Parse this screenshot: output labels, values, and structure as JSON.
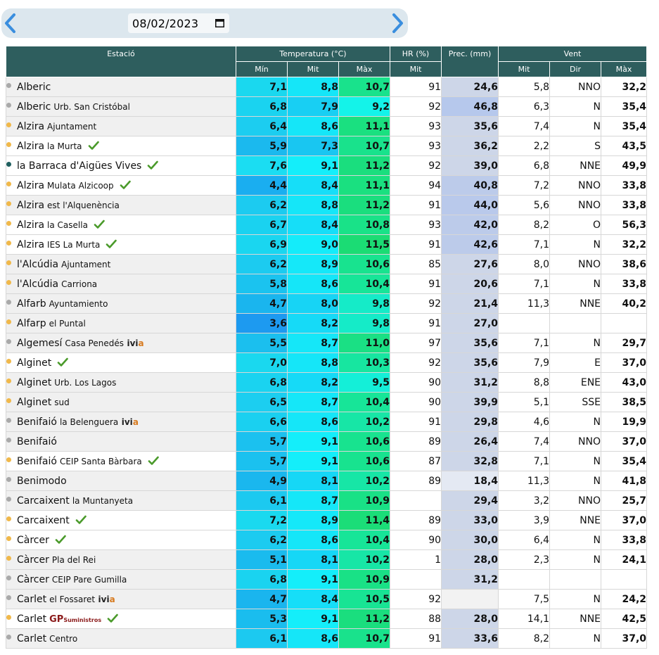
{
  "nav": {
    "date": "08/02/2023",
    "prev_icon": "chevron-left-icon",
    "next_icon": "chevron-right-icon",
    "calendar_icon": "calendar-icon"
  },
  "header": {
    "station": "Estació",
    "temperature": "Temperatura (°C)",
    "hr": "HR (%)",
    "prec": "Prec. (mm)",
    "wind": "Vent",
    "t_min": "Mín",
    "t_mit": "Mit",
    "t_max": "Màx",
    "hr_mit": "Mit",
    "w_mit": "Mit",
    "w_dir": "Dir",
    "w_max": "Màx"
  },
  "colors": {
    "header_bg": "#2e5e5e",
    "dot_gray": "#a9a9a9",
    "dot_orange": "#f0b84a",
    "dot_teal": "#1f5f5f",
    "check_green": "#4a9a2a"
  },
  "rows": [
    {
      "name": "Alberic",
      "sub": "",
      "dot": "gray",
      "check": false,
      "ivia": false,
      "gp": false,
      "min": "7,1",
      "mit": "8,8",
      "max": "10,7",
      "hr": "91",
      "prec": "24,6",
      "wmit": "5,8",
      "wdir": "NNO",
      "wmax": "32,2",
      "shade": "gray",
      "minc": "#1ad8ef",
      "mitc": "#15e6f8",
      "maxc": "#19e28c",
      "precc": "#cdd6e8"
    },
    {
      "name": "Alberic",
      "sub": "Urb. San Cristóbal",
      "dot": "gray",
      "check": false,
      "ivia": false,
      "gp": false,
      "min": "6,8",
      "mit": "7,9",
      "max": "9,2",
      "hr": "92",
      "prec": "46,8",
      "wmit": "6,3",
      "wdir": "N",
      "wmax": "35,4",
      "shade": "gray",
      "minc": "#1ad3f0",
      "mitc": "#18cff3",
      "maxc": "#14f3e9",
      "precc": "#b6c8ec"
    },
    {
      "name": "Alzira",
      "sub": "Ajuntament",
      "dot": "orange",
      "check": false,
      "ivia": false,
      "gp": false,
      "min": "6,4",
      "mit": "8,6",
      "max": "11,1",
      "hr": "93",
      "prec": "35,6",
      "wmit": "7,4",
      "wdir": "N",
      "wmax": "35,4",
      "shade": "gray",
      "minc": "#1ccdf0",
      "mitc": "#15e6f8",
      "maxc": "#1ae080",
      "precc": "#cdd6e8"
    },
    {
      "name": "Alzira",
      "sub": "la Murta",
      "dot": "orange",
      "check": true,
      "ivia": false,
      "gp": false,
      "min": "5,9",
      "mit": "7,3",
      "max": "10,7",
      "hr": "93",
      "prec": "36,2",
      "wmit": "2,2",
      "wdir": "S",
      "wmax": "43,5",
      "shade": "white",
      "minc": "#1bb9ee",
      "mitc": "#19c6f1",
      "maxc": "#19e28c",
      "precc": "#cdd6e8"
    },
    {
      "name": "la Barraca d'Aigües Vives",
      "sub": "",
      "dot": "teal",
      "check": true,
      "ivia": false,
      "gp": false,
      "min": "7,6",
      "mit": "9,1",
      "max": "11,2",
      "hr": "92",
      "prec": "39,0",
      "wmit": "6,8",
      "wdir": "NNE",
      "wmax": "49,9",
      "shade": "white",
      "minc": "#1bddf2",
      "mitc": "#14eefa",
      "maxc": "#1ade7e",
      "precc": "#cdd6e8"
    },
    {
      "name": "Alzira",
      "sub": "Mulata Alzicoop",
      "dot": "orange",
      "check": true,
      "ivia": false,
      "gp": false,
      "min": "4,4",
      "mit": "8,4",
      "max": "11,1",
      "hr": "94",
      "prec": "40,8",
      "wmit": "7,2",
      "wdir": "NNO",
      "wmax": "33,8",
      "shade": "white",
      "minc": "#1aaef0",
      "mitc": "#16def8",
      "maxc": "#1ae080",
      "precc": "#bccbea"
    },
    {
      "name": "Alzira",
      "sub": "est l'Alquenència",
      "dot": "orange",
      "check": false,
      "ivia": false,
      "gp": false,
      "min": "6,2",
      "mit": "8,8",
      "max": "11,2",
      "hr": "91",
      "prec": "44,0",
      "wmit": "5,6",
      "wdir": "NNO",
      "wmax": "33,8",
      "shade": "gray",
      "minc": "#1ccbf0",
      "mitc": "#15e6f8",
      "maxc": "#1ade7e",
      "precc": "#b9c9eb"
    },
    {
      "name": "Alzira",
      "sub": "la Casella",
      "dot": "orange",
      "check": true,
      "ivia": false,
      "gp": false,
      "min": "6,7",
      "mit": "8,4",
      "max": "10,8",
      "hr": "93",
      "prec": "42,0",
      "wmit": "8,2",
      "wdir": "O",
      "wmax": "56,3",
      "shade": "white",
      "minc": "#1ad2f0",
      "mitc": "#16def8",
      "maxc": "#19e288",
      "precc": "#bccbea"
    },
    {
      "name": "Alzira",
      "sub": "IES La Murta",
      "dot": "orange",
      "check": true,
      "ivia": false,
      "gp": false,
      "min": "6,9",
      "mit": "9,0",
      "max": "11,5",
      "hr": "91",
      "prec": "42,6",
      "wmit": "7,1",
      "wdir": "N",
      "wmax": "32,2",
      "shade": "white",
      "minc": "#1ad6f0",
      "mitc": "#14ecfa",
      "maxc": "#1bdc74",
      "precc": "#bccbea"
    },
    {
      "name": "l'Alcúdia",
      "sub": "Ajuntament",
      "dot": "orange",
      "check": false,
      "ivia": false,
      "gp": false,
      "min": "6,2",
      "mit": "8,9",
      "max": "10,6",
      "hr": "85",
      "prec": "27,6",
      "wmit": "8,0",
      "wdir": "NNO",
      "wmax": "38,6",
      "shade": "gray",
      "minc": "#1ccbf0",
      "mitc": "#15e8f9",
      "maxc": "#18e38f",
      "precc": "#cdd6e8"
    },
    {
      "name": "l'Alcúdia",
      "sub": "Carriona",
      "dot": "orange",
      "check": false,
      "ivia": false,
      "gp": false,
      "min": "5,8",
      "mit": "8,6",
      "max": "10,4",
      "hr": "91",
      "prec": "20,6",
      "wmit": "7,1",
      "wdir": "N",
      "wmax": "33,8",
      "shade": "gray",
      "minc": "#1bc3ef",
      "mitc": "#15e6f8",
      "maxc": "#17e598",
      "precc": "#cdd6e8"
    },
    {
      "name": "Alfarb",
      "sub": "Ayuntamiento",
      "dot": "gray",
      "check": false,
      "ivia": false,
      "gp": false,
      "min": "4,7",
      "mit": "8,0",
      "max": "9,8",
      "hr": "92",
      "prec": "21,4",
      "wmit": "11,3",
      "wdir": "NNE",
      "wmax": "40,2",
      "shade": "gray",
      "minc": "#1ab5ee",
      "mitc": "#17d4f5",
      "maxc": "#15ebc8",
      "precc": "#cdd6e8"
    },
    {
      "name": "Alfarp",
      "sub": "el Puntal",
      "dot": "orange",
      "check": false,
      "ivia": false,
      "gp": false,
      "min": "3,6",
      "mit": "8,2",
      "max": "9,8",
      "hr": "91",
      "prec": "27,0",
      "wmit": "",
      "wdir": "",
      "wmax": "",
      "shade": "gray",
      "minc": "#1d9af0",
      "mitc": "#16daf7",
      "maxc": "#15ebc8",
      "precc": "#cdd6e8"
    },
    {
      "name": "Algemesí",
      "sub": "Casa Penedés",
      "dot": "gray",
      "check": false,
      "ivia": true,
      "gp": false,
      "min": "5,5",
      "mit": "8,7",
      "max": "11,0",
      "hr": "97",
      "prec": "35,6",
      "wmit": "7,1",
      "wdir": "N",
      "wmax": "29,7",
      "shade": "gray",
      "minc": "#1bbfee",
      "mitc": "#15e7f8",
      "maxc": "#1ae084",
      "precc": "#cdd6e8"
    },
    {
      "name": "Alginet",
      "sub": "",
      "dot": "orange",
      "check": true,
      "ivia": false,
      "gp": false,
      "min": "7,0",
      "mit": "8,8",
      "max": "10,3",
      "hr": "92",
      "prec": "35,6",
      "wmit": "7,9",
      "wdir": "E",
      "wmax": "37,0",
      "shade": "white",
      "minc": "#1ad8ef",
      "mitc": "#15e6f8",
      "maxc": "#17e6a0",
      "precc": "#cdd6e8"
    },
    {
      "name": "Alginet",
      "sub": "Urb. Los Lagos",
      "dot": "orange",
      "check": false,
      "ivia": false,
      "gp": false,
      "min": "6,8",
      "mit": "8,2",
      "max": "9,5",
      "hr": "90",
      "prec": "31,2",
      "wmit": "8,8",
      "wdir": "ENE",
      "wmax": "43,0",
      "shade": "gray",
      "minc": "#1ad3f0",
      "mitc": "#16daf7",
      "maxc": "#14efd8",
      "precc": "#cdd6e8"
    },
    {
      "name": "Alginet",
      "sub": "sud",
      "dot": "orange",
      "check": false,
      "ivia": false,
      "gp": false,
      "min": "6,5",
      "mit": "8,7",
      "max": "10,4",
      "hr": "90",
      "prec": "39,9",
      "wmit": "5,1",
      "wdir": "SSE",
      "wmax": "38,5",
      "shade": "gray",
      "minc": "#1ccef0",
      "mitc": "#15e7f8",
      "maxc": "#17e598",
      "precc": "#cdd6e8"
    },
    {
      "name": "Benifaió",
      "sub": "la Belenguera",
      "dot": "gray",
      "check": false,
      "ivia": true,
      "gp": false,
      "min": "6,6",
      "mit": "8,6",
      "max": "10,2",
      "hr": "91",
      "prec": "29,8",
      "wmit": "4,6",
      "wdir": "N",
      "wmax": "19,9",
      "shade": "gray",
      "minc": "#1ad0f0",
      "mitc": "#15e6f8",
      "maxc": "#17e6a6",
      "precc": "#cdd6e8"
    },
    {
      "name": "Benifaió",
      "sub": "",
      "dot": "gray",
      "check": false,
      "ivia": false,
      "gp": false,
      "min": "5,7",
      "mit": "9,1",
      "max": "10,6",
      "hr": "89",
      "prec": "26,4",
      "wmit": "7,4",
      "wdir": "NNO",
      "wmax": "37,0",
      "shade": "gray",
      "minc": "#1bc1ef",
      "mitc": "#14eefa",
      "maxc": "#18e38f",
      "precc": "#cdd6e8"
    },
    {
      "name": "Benifaió",
      "sub": "CEIP Santa Bàrbara",
      "dot": "orange",
      "check": true,
      "ivia": false,
      "gp": false,
      "min": "5,7",
      "mit": "9,1",
      "max": "10,6",
      "hr": "87",
      "prec": "32,8",
      "wmit": "7,1",
      "wdir": "N",
      "wmax": "35,4",
      "shade": "white",
      "minc": "#1bc1ef",
      "mitc": "#14eefa",
      "maxc": "#18e38f",
      "precc": "#cdd6e8"
    },
    {
      "name": "Benimodo",
      "sub": "",
      "dot": "gray",
      "check": false,
      "ivia": false,
      "gp": false,
      "min": "4,9",
      "mit": "8,1",
      "max": "10,2",
      "hr": "89",
      "prec": "18,4",
      "wmit": "11,3",
      "wdir": "N",
      "wmax": "41,8",
      "shade": "gray",
      "minc": "#1ab7ee",
      "mitc": "#16d7f6",
      "maxc": "#17e6a6",
      "precc": "#e4e9f3"
    },
    {
      "name": "Carcaixent",
      "sub": "la Muntanyeta",
      "dot": "gray",
      "check": false,
      "ivia": false,
      "gp": false,
      "min": "6,1",
      "mit": "8,7",
      "max": "10,9",
      "hr": "",
      "prec": "29,4",
      "wmit": "3,2",
      "wdir": "NNO",
      "wmax": "25,7",
      "shade": "gray",
      "minc": "#1cc9f0",
      "mitc": "#15e7f8",
      "maxc": "#19e186",
      "precc": "#cdd6e8"
    },
    {
      "name": "Carcaixent",
      "sub": "",
      "dot": "orange",
      "check": true,
      "ivia": false,
      "gp": false,
      "min": "7,2",
      "mit": "8,9",
      "max": "11,4",
      "hr": "89",
      "prec": "33,0",
      "wmit": "3,9",
      "wdir": "NNE",
      "wmax": "37,0",
      "shade": "white",
      "minc": "#1ad9ef",
      "mitc": "#15e8f9",
      "maxc": "#1bdd78",
      "precc": "#cdd6e8"
    },
    {
      "name": "Càrcer",
      "sub": "",
      "dot": "orange",
      "check": true,
      "ivia": false,
      "gp": false,
      "min": "6,2",
      "mit": "8,6",
      "max": "10,4",
      "hr": "90",
      "prec": "30,0",
      "wmit": "6,4",
      "wdir": "N",
      "wmax": "33,8",
      "shade": "white",
      "minc": "#1ccbf0",
      "mitc": "#15e6f8",
      "maxc": "#17e598",
      "precc": "#cdd6e8"
    },
    {
      "name": "Càrcer",
      "sub": "Pla del Rei",
      "dot": "orange",
      "check": false,
      "ivia": false,
      "gp": false,
      "min": "5,1",
      "mit": "8,1",
      "max": "10,2",
      "hr": "1",
      "prec": "28,0",
      "wmit": "2,3",
      "wdir": "N",
      "wmax": "24,1",
      "shade": "gray",
      "minc": "#1abbee",
      "mitc": "#16d7f6",
      "maxc": "#17e6a6",
      "precc": "#cdd6e8"
    },
    {
      "name": "Càrcer",
      "sub": "CEIP Pare Gumilla",
      "dot": "gray",
      "check": false,
      "ivia": false,
      "gp": false,
      "min": "6,8",
      "mit": "9,1",
      "max": "10,9",
      "hr": "",
      "prec": "31,2",
      "wmit": "",
      "wdir": "",
      "wmax": "",
      "shade": "gray",
      "minc": "#1ad3f0",
      "mitc": "#14eefa",
      "maxc": "#19e186",
      "precc": "#cdd6e8"
    },
    {
      "name": "Carlet",
      "sub": "el Fossaret",
      "dot": "gray",
      "check": false,
      "ivia": true,
      "gp": false,
      "min": "4,7",
      "mit": "8,4",
      "max": "10,5",
      "hr": "92",
      "prec": "",
      "wmit": "7,5",
      "wdir": "N",
      "wmax": "24,2",
      "shade": "gray",
      "minc": "#1ab5ee",
      "mitc": "#16def8",
      "maxc": "#18e494",
      "precc": "#f2f2f2"
    },
    {
      "name": "Carlet",
      "sub": "",
      "dot": "orange",
      "check": true,
      "ivia": false,
      "gp": true,
      "min": "5,3",
      "mit": "9,1",
      "max": "11,2",
      "hr": "88",
      "prec": "28,0",
      "wmit": "14,1",
      "wdir": "NNE",
      "wmax": "42,5",
      "shade": "white",
      "minc": "#1abdee",
      "mitc": "#14eefa",
      "maxc": "#1ade7e",
      "precc": "#cdd6e8"
    },
    {
      "name": "Carlet",
      "sub": "Centro",
      "dot": "gray",
      "check": false,
      "ivia": false,
      "gp": false,
      "min": "6,1",
      "mit": "8,6",
      "max": "10,7",
      "hr": "91",
      "prec": "33,6",
      "wmit": "8,2",
      "wdir": "N",
      "wmax": "37,0",
      "shade": "gray",
      "minc": "#1cc9f0",
      "mitc": "#15e6f8",
      "maxc": "#19e28c",
      "precc": "#cdd6e8"
    }
  ],
  "ivia_label": {
    "a": "ivi",
    "b": "a"
  },
  "gp_label": {
    "a": "GP",
    "b": "Suministros"
  }
}
